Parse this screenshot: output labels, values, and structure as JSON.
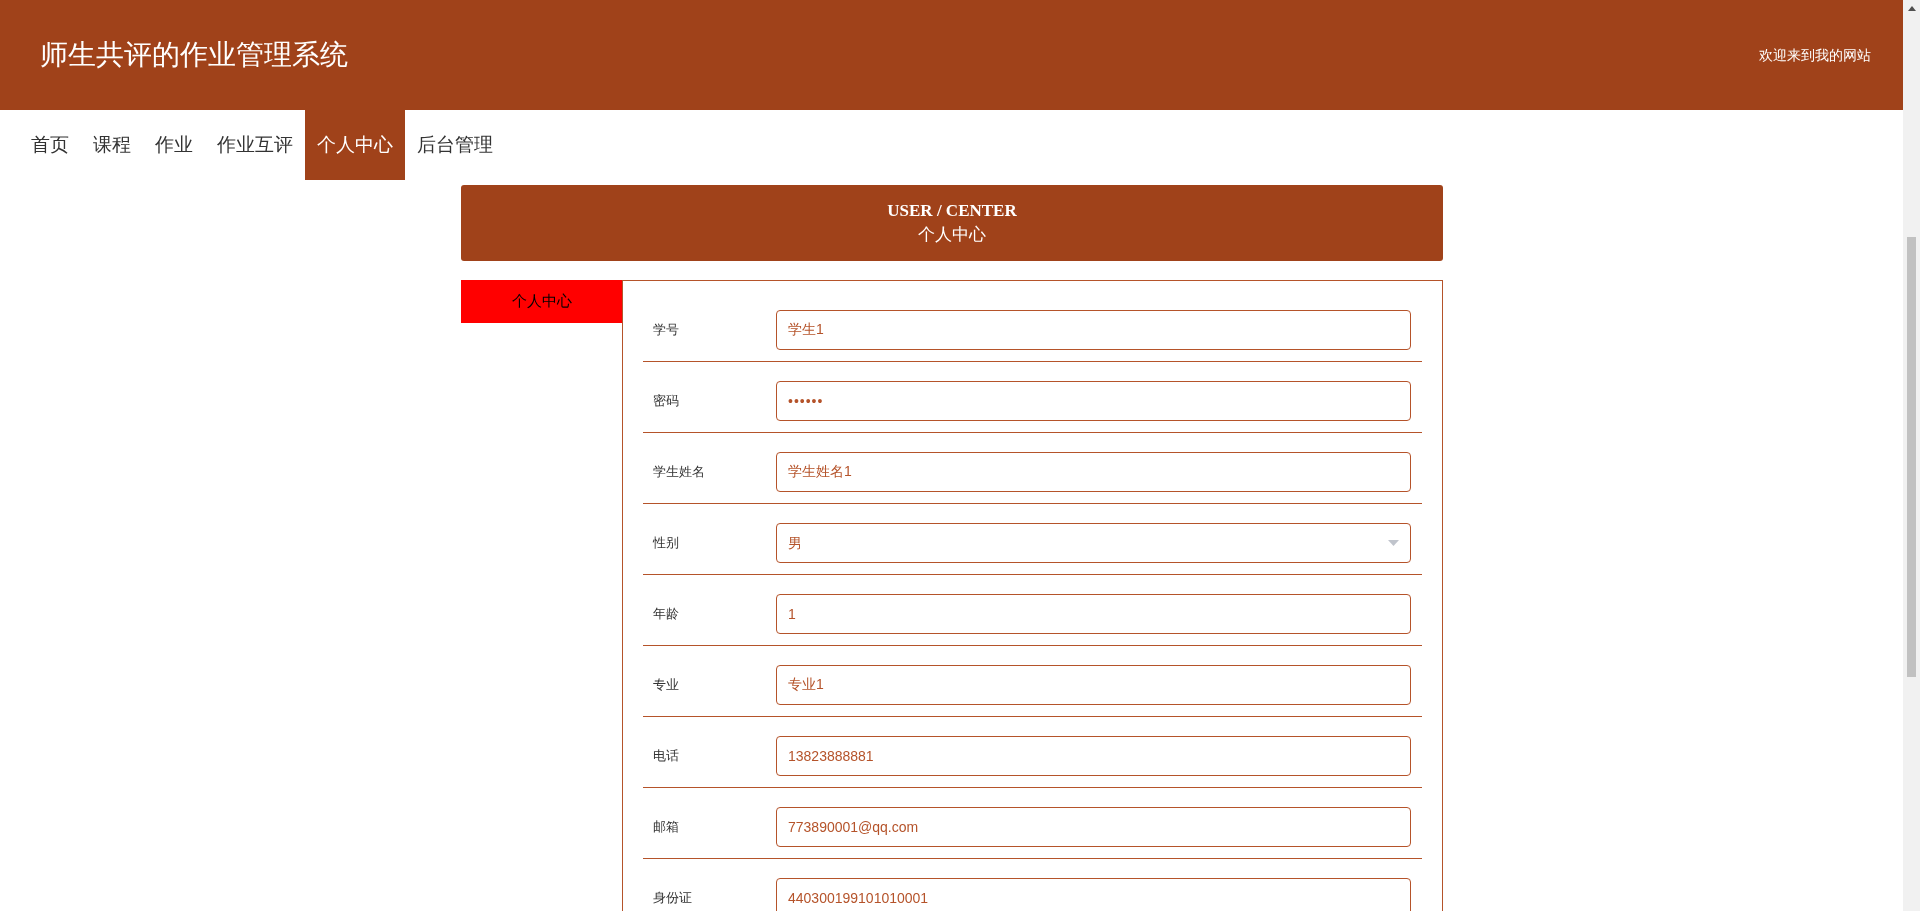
{
  "header": {
    "title": "师生共评的作业管理系统",
    "welcome": "欢迎来到我的网站"
  },
  "nav": [
    {
      "label": "首页",
      "selected": false
    },
    {
      "label": "课程",
      "selected": false
    },
    {
      "label": "作业",
      "selected": false
    },
    {
      "label": "作业互评",
      "selected": false
    },
    {
      "label": "个人中心",
      "selected": true
    },
    {
      "label": "后台管理",
      "selected": false
    }
  ],
  "banner": {
    "title_en": "USER / CENTER",
    "title": "个人中心"
  },
  "side_tabs": [
    {
      "label": "个人中心",
      "selected": true
    }
  ],
  "fields": [
    {
      "kind": "text",
      "label": "学号",
      "value": "学生1"
    },
    {
      "kind": "password",
      "label": "密码",
      "value": "••••••"
    },
    {
      "kind": "text",
      "label": "学生姓名",
      "value": "学生姓名1"
    },
    {
      "kind": "select",
      "label": "性别",
      "value": "男"
    },
    {
      "kind": "text",
      "label": "年龄",
      "value": "1"
    },
    {
      "kind": "text",
      "label": "专业",
      "value": "专业1"
    },
    {
      "kind": "text",
      "label": "电话",
      "value": "13823888881"
    },
    {
      "kind": "text",
      "label": "邮箱",
      "value": "773890001@qq.com"
    },
    {
      "kind": "text",
      "label": "身份证",
      "value": "440300199101010001"
    }
  ]
}
